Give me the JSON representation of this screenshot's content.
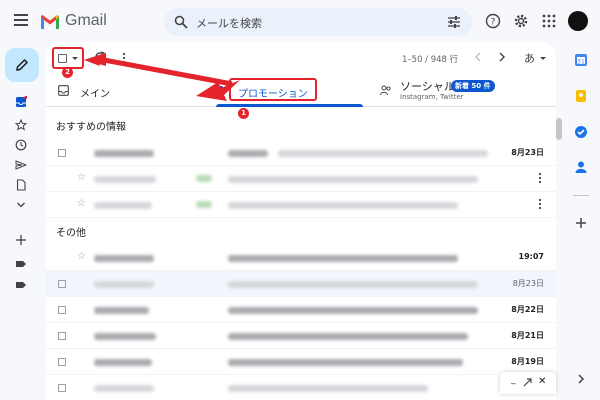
{
  "header": {
    "app_name": "Gmail",
    "search_placeholder": "メールを検索"
  },
  "toolbar": {
    "pager_text": "1–50 / 948 行",
    "input_tool_label": "あ"
  },
  "tabs": [
    {
      "label": "メイン"
    },
    {
      "label": "プロモーション",
      "selected": true
    },
    {
      "label": "ソーシャル",
      "badge": "新着 50 件",
      "subtitle": "Instagram, Twitter"
    }
  ],
  "sections": {
    "recommended": "おすすめの情報",
    "other": "その他"
  },
  "rows": [
    {
      "date": "8月23日",
      "bold": true
    },
    {
      "date": "",
      "bold": false
    },
    {
      "date": "",
      "bold": false
    },
    {
      "date": "19:07",
      "bold": true
    },
    {
      "date": "8月23日",
      "bold": false
    },
    {
      "date": "8月22日",
      "bold": true
    },
    {
      "date": "8月21日",
      "bold": true
    },
    {
      "date": "8月19日",
      "bold": true
    }
  ],
  "annotations": {
    "marker_1": "1",
    "marker_2": "2",
    "color": "#e5232b"
  },
  "colors": {
    "accent": "#0b57d0",
    "compose_bg": "#c2e7ff",
    "search_bg": "#eaf1fb"
  }
}
